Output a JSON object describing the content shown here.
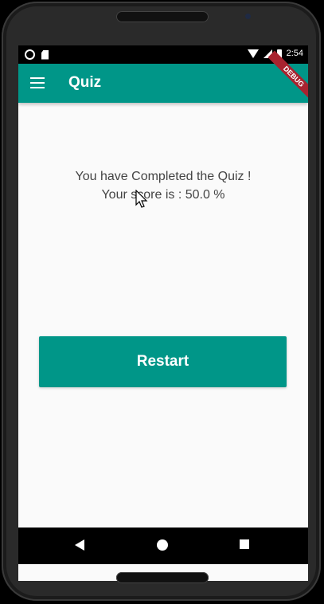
{
  "status_bar": {
    "time": "2:54",
    "icons": [
      "notification-circle-icon",
      "sd-card-icon",
      "wifi-icon",
      "signal-icon",
      "battery-icon"
    ]
  },
  "app_bar": {
    "title": "Quiz",
    "menu_icon": "hamburger-menu-icon",
    "debug_label": "DEBUG",
    "color": "#009688"
  },
  "result": {
    "line1": "You have Completed the Quiz !",
    "line2": "Your score is : 50.0 %"
  },
  "restart_button": {
    "label": "Restart"
  },
  "nav_bar": {
    "icons": [
      "back-icon",
      "home-icon",
      "recent-apps-icon"
    ]
  },
  "colors": {
    "primary": "#009688",
    "background": "#fafafa",
    "text": "#444444",
    "debug_banner": "#a8232f"
  }
}
